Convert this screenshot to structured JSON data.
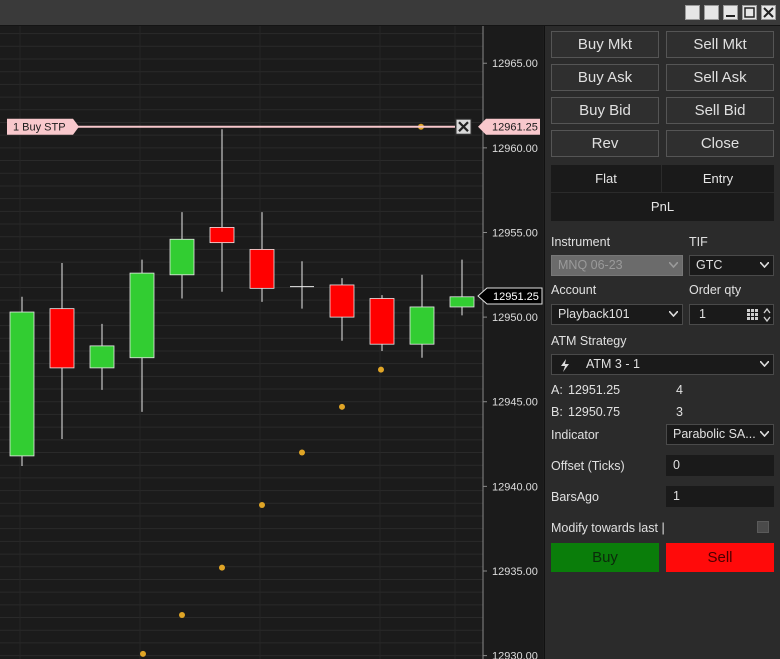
{
  "window": {
    "buttons": [
      "link-icon",
      "link-icon",
      "minimize-icon",
      "maximize-icon",
      "close-icon"
    ]
  },
  "chart": {
    "price_axis": {
      "ticks": [
        "12965.00",
        "12960.00",
        "12955.00",
        "12950.00",
        "12945.00",
        "12940.00",
        "12935.00",
        "12930.00"
      ],
      "current_price_label": "12951.25",
      "order_price_label": "12961.25"
    },
    "order": {
      "label": "1  Buy STP",
      "price": 12961.25,
      "color": "#f8c8cc"
    },
    "colors": {
      "up": "#32cd32",
      "down": "#ff0000",
      "sar": "#e0a526"
    }
  },
  "chart_data": {
    "type": "candlestick",
    "title": "",
    "ylim": [
      12929.8,
      12967.2
    ],
    "up_color": "#32cd32",
    "down_color": "#ff0000",
    "candles": [
      {
        "o": 12941.8,
        "h": 12951.2,
        "l": 12941.2,
        "c": 12950.3
      },
      {
        "o": 12950.5,
        "h": 12953.2,
        "l": 12942.8,
        "c": 12947.0
      },
      {
        "o": 12947.0,
        "h": 12949.6,
        "l": 12945.7,
        "c": 12948.3
      },
      {
        "o": 12947.6,
        "h": 12953.4,
        "l": 12944.4,
        "c": 12952.6
      },
      {
        "o": 12952.5,
        "h": 12956.2,
        "l": 12951.1,
        "c": 12954.6
      },
      {
        "o": 12955.3,
        "h": 12961.1,
        "l": 12951.5,
        "c": 12954.4
      },
      {
        "o": 12954.0,
        "h": 12956.2,
        "l": 12950.9,
        "c": 12951.7
      },
      {
        "o": 12951.8,
        "h": 12953.3,
        "l": 12950.5,
        "c": 12951.8
      },
      {
        "o": 12951.9,
        "h": 12952.3,
        "l": 12948.6,
        "c": 12950.0
      },
      {
        "o": 12951.1,
        "h": 12951.3,
        "l": 12948.0,
        "c": 12948.4
      },
      {
        "o": 12948.4,
        "h": 12952.5,
        "l": 12947.6,
        "c": 12950.6
      },
      {
        "o": 12950.6,
        "h": 12953.4,
        "l": 12950.1,
        "c": 12951.2
      }
    ],
    "sar": [
      12930.1,
      12932.4,
      12935.2,
      12938.9,
      12942.0,
      12944.7,
      12946.9,
      12961.25
    ]
  },
  "panel": {
    "buttons": {
      "buy_mkt": "Buy Mkt",
      "sell_mkt": "Sell Mkt",
      "buy_ask": "Buy Ask",
      "sell_ask": "Sell Ask",
      "buy_bid": "Buy Bid",
      "sell_bid": "Sell Bid",
      "rev": "Rev",
      "close": "Close"
    },
    "position": {
      "flat": "Flat",
      "entry": "Entry",
      "pnl": "PnL"
    },
    "instrument_label": "Instrument",
    "instrument_value": "MNQ 06-23",
    "tif_label": "TIF",
    "tif_value": "GTC",
    "account_label": "Account",
    "account_value": "Playback101",
    "orderqty_label": "Order qty",
    "orderqty_value": "1",
    "atm_label": "ATM Strategy",
    "atm_value": "ATM 3 - 1",
    "ask_label": "A:",
    "ask_price": "12951.25",
    "ask_size": "4",
    "bid_label": "B:",
    "bid_price": "12950.75",
    "bid_size": "3",
    "indicator_label": "Indicator",
    "indicator_value": "Parabolic SA...",
    "offset_label": "Offset (Ticks)",
    "offset_value": "0",
    "barsago_label": "BarsAgo",
    "barsago_value": "1",
    "modify_label": "Modify towards last |",
    "buy_label": "Buy",
    "sell_label": "Sell",
    "buy_color": "#0a7d0a",
    "sell_color": "#ff0a0a"
  }
}
